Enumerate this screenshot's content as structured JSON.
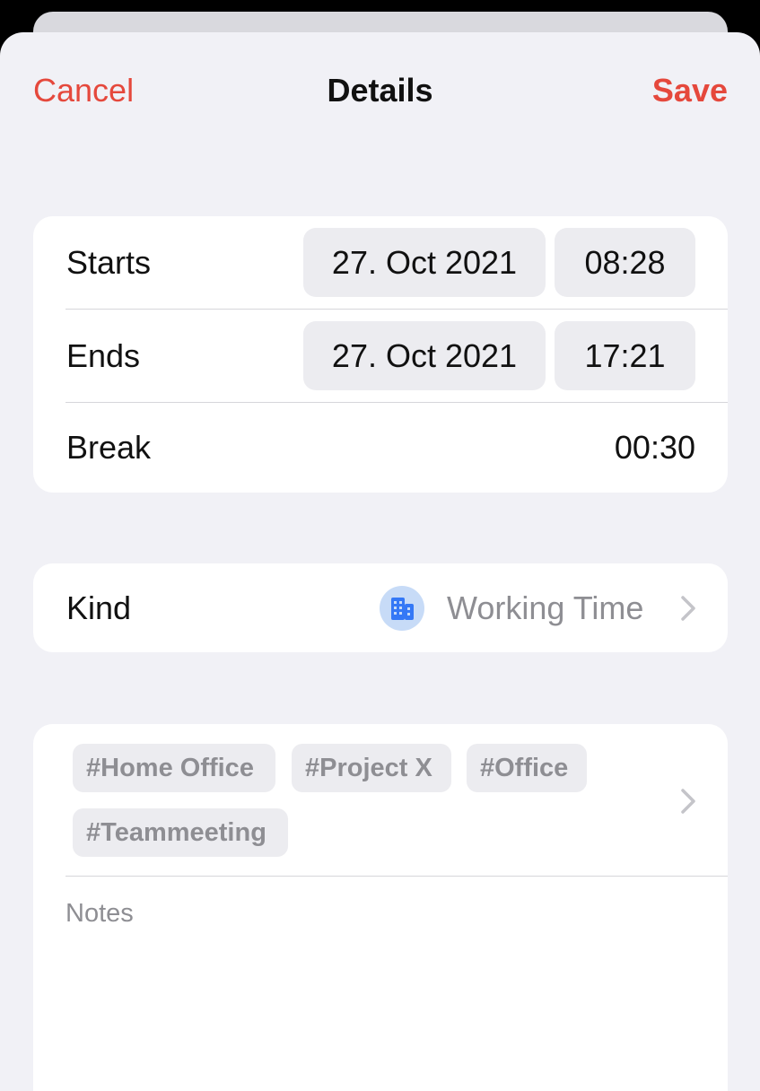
{
  "nav": {
    "cancel_label": "Cancel",
    "title": "Details",
    "save_label": "Save"
  },
  "times": {
    "starts": {
      "label": "Starts",
      "date": "27. Oct 2021",
      "time": "08:28"
    },
    "ends": {
      "label": "Ends",
      "date": "27. Oct 2021",
      "time": "17:21"
    },
    "break": {
      "label": "Break",
      "value": "00:30"
    }
  },
  "kind": {
    "label": "Kind",
    "value": "Working Time",
    "icon": "building-icon"
  },
  "tags": [
    "#Home Office",
    "#Project X",
    "#Office",
    "#Teammeeting"
  ],
  "notes": {
    "placeholder": "Notes",
    "value": ""
  },
  "colors": {
    "accent": "#e5483c",
    "background": "#f1f1f6",
    "secondary_text": "#8e8e93",
    "icon_blue": "#3478f6",
    "icon_bg": "#c7dbf7"
  }
}
